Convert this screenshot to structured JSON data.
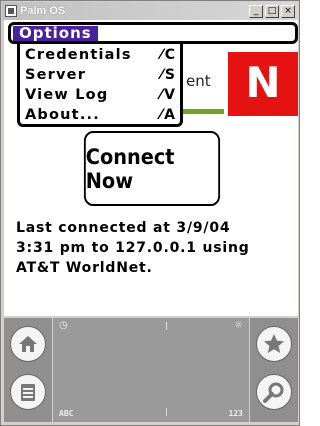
{
  "window": {
    "title": "Palm OS",
    "minimize": "_",
    "maximize": "□",
    "close": "×"
  },
  "menu": {
    "title": "Options",
    "items": [
      {
        "label": "Credentials",
        "shortcut": "⁄C"
      },
      {
        "label": "Server",
        "shortcut": "⁄S"
      },
      {
        "label": "View Log",
        "shortcut": "⁄V"
      },
      {
        "label": "About...",
        "shortcut": "⁄A"
      }
    ]
  },
  "logo": {
    "partial_text": "ent",
    "letter": "N",
    "colors": {
      "red": "#e51212",
      "green": "#6fa51e"
    }
  },
  "connect_button": {
    "label": "Connect Now"
  },
  "status": {
    "line1": "Last connected at 3/9/04",
    "line2": "3:31 pm to 127.0.0.1 using",
    "line3": "AT&T WorldNet."
  },
  "graffiti": {
    "abc_label": "ABC",
    "num_label": "123",
    "icons": [
      "home-icon",
      "menu-icon",
      "favorites-icon",
      "find-icon",
      "clock-icon",
      "brightness-icon"
    ]
  },
  "colors": {
    "menu_highlight": "#4a1fa0"
  }
}
